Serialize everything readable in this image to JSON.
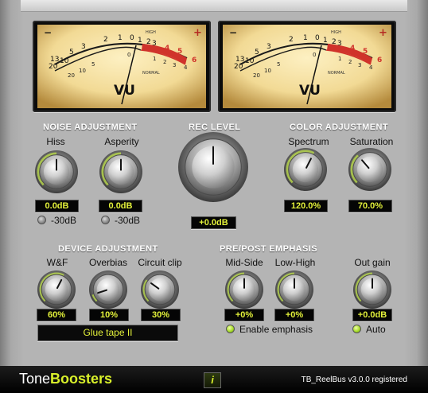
{
  "meters": {
    "left": {
      "scale_top": [
        "20",
        "10",
        "5",
        "3",
        "2",
        "1",
        "0",
        "1",
        "2",
        "3"
      ],
      "scale_top_left": "13",
      "red_labels": [
        "4",
        "5",
        "6"
      ],
      "scale_bottom": [
        "20",
        "10",
        "5",
        "0",
        "1",
        "2",
        "3",
        "4"
      ],
      "minus": "−",
      "plus": "+",
      "high_label": "HIGH",
      "normal_label": "NORMAL",
      "vu_label": "VU"
    },
    "right": {
      "scale_top": [
        "20",
        "10",
        "5",
        "3",
        "2",
        "1",
        "0",
        "1",
        "2",
        "3"
      ],
      "scale_top_left": "13",
      "red_labels": [
        "4",
        "5",
        "6"
      ],
      "scale_bottom": [
        "20",
        "10",
        "5",
        "0",
        "1",
        "2",
        "3",
        "4"
      ],
      "minus": "−",
      "plus": "+",
      "high_label": "HIGH",
      "normal_label": "NORMAL",
      "vu_label": "VU"
    }
  },
  "noise": {
    "heading": "NOISE ADJUSTMENT",
    "hiss": {
      "label": "Hiss",
      "value": "0.0dB",
      "toggle_label": "-30dB",
      "toggle_on": false
    },
    "asperity": {
      "label": "Asperity",
      "value": "0.0dB",
      "toggle_label": "-30dB",
      "toggle_on": false
    }
  },
  "rec": {
    "heading": "REC LEVEL",
    "value": "+0.0dB"
  },
  "color": {
    "heading": "COLOR ADJUSTMENT",
    "spectrum": {
      "label": "Spectrum",
      "value": "120.0%"
    },
    "saturation": {
      "label": "Saturation",
      "value": "70.0%"
    }
  },
  "device": {
    "heading": "DEVICE ADJUSTMENT",
    "wf": {
      "label": "W&F",
      "value": "60%"
    },
    "overbias": {
      "label": "Overbias",
      "value": "10%"
    },
    "circuit_clip": {
      "label": "Circuit clip",
      "value": "30%"
    },
    "tape_select": "Glue tape II"
  },
  "emphasis": {
    "heading": "PRE/POST EMPHASIS",
    "mid_side": {
      "label": "Mid-Side",
      "value": "+0%"
    },
    "low_high": {
      "label": "Low-High",
      "value": "+0%"
    },
    "enable_label": "Enable emphasis",
    "enable_on": true
  },
  "out": {
    "label": "Out gain",
    "value": "+0.0dB",
    "auto_label": "Auto",
    "auto_on": true
  },
  "footer": {
    "brand_a": "Tone",
    "brand_b": "Boosters",
    "info_icon": "info-icon",
    "info_glyph": "i",
    "version": "TB_ReelBus v3.0.0 registered"
  },
  "colors": {
    "display_text": "#e3f13a",
    "led_on": "#a8dc2c",
    "meter_red": "#d0332b",
    "brand_accent": "#d8f02a"
  }
}
